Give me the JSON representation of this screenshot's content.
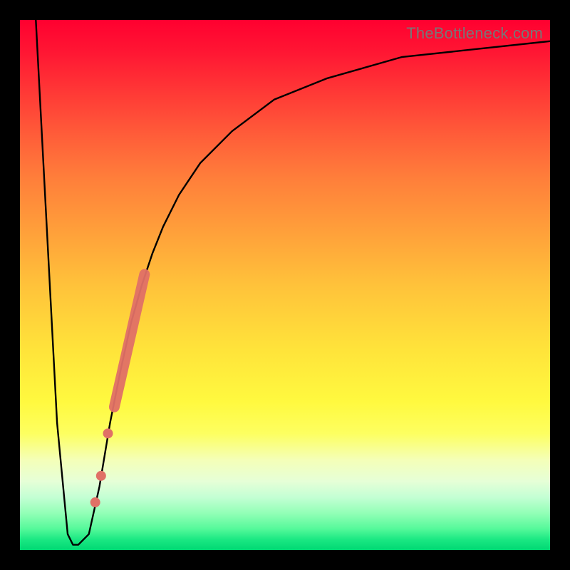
{
  "watermark": "TheBottleneck.com",
  "chart_data": {
    "type": "line",
    "title": "",
    "xlabel": "",
    "ylabel": "",
    "xlim": [
      0,
      100
    ],
    "ylim": [
      0,
      100
    ],
    "grid": false,
    "series": [
      {
        "name": "bottleneck-curve",
        "x": [
          3,
          5,
          7,
          9,
          10,
          11,
          13,
          15,
          17,
          19,
          21,
          23,
          25,
          27,
          30,
          34,
          40,
          48,
          58,
          72,
          100
        ],
        "y": [
          100,
          62,
          24,
          3,
          1,
          1,
          3,
          12,
          24,
          34,
          43,
          50,
          56,
          61,
          67,
          73,
          79,
          85,
          89,
          93,
          96
        ]
      }
    ],
    "highlight_segment": {
      "name": "ribbon",
      "x": [
        17.8,
        23.5
      ],
      "y": [
        27,
        52
      ]
    },
    "highlight_points": {
      "name": "dots",
      "points": [
        {
          "x": 14.2,
          "y": 9
        },
        {
          "x": 15.3,
          "y": 14
        },
        {
          "x": 16.6,
          "y": 22
        }
      ]
    },
    "gradient_bands": [
      {
        "pos": 0,
        "color": "#ff0030"
      },
      {
        "pos": 50,
        "color": "#ffc23a"
      },
      {
        "pos": 78,
        "color": "#fdff60"
      },
      {
        "pos": 100,
        "color": "#00d873"
      }
    ]
  }
}
